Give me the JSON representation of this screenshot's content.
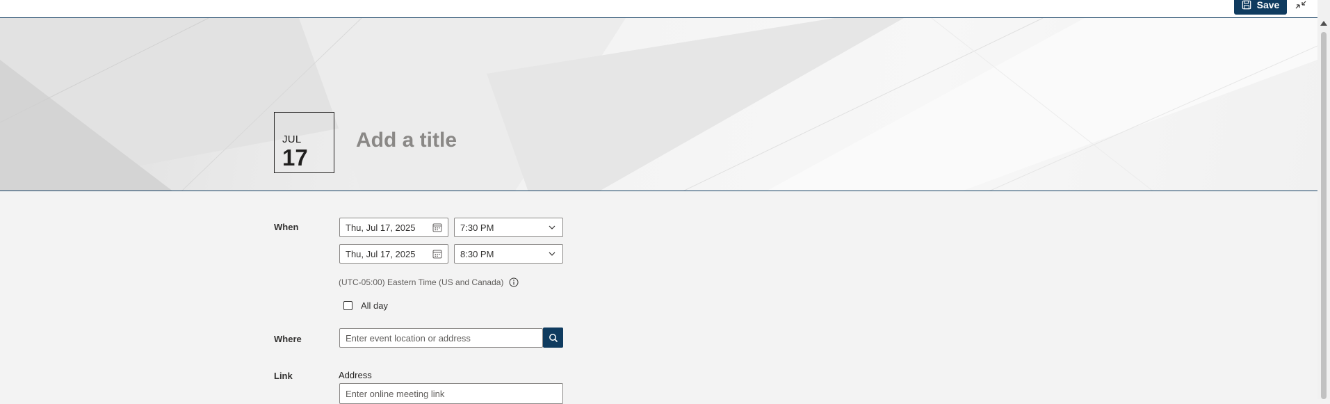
{
  "toolbar": {
    "save_label": "Save",
    "save_icon": "save-icon",
    "collapse_icon": "collapse-icon"
  },
  "hero": {
    "month": "JUL",
    "day": "17",
    "title_placeholder": "Add a title"
  },
  "form": {
    "when_label": "When",
    "start_date": "Thu, Jul 17, 2025",
    "start_time": "7:30 PM",
    "end_date": "Thu, Jul 17, 2025",
    "end_time": "8:30 PM",
    "timezone": "(UTC-05:00) Eastern Time (US and Canada)",
    "all_day_label": "All day",
    "where_label": "Where",
    "location_placeholder": "Enter event location or address",
    "link_label": "Link",
    "address_label": "Address",
    "link_placeholder": "Enter online meeting link"
  },
  "colors": {
    "accent": "#0f3b5f",
    "background": "#f3f3f3"
  }
}
